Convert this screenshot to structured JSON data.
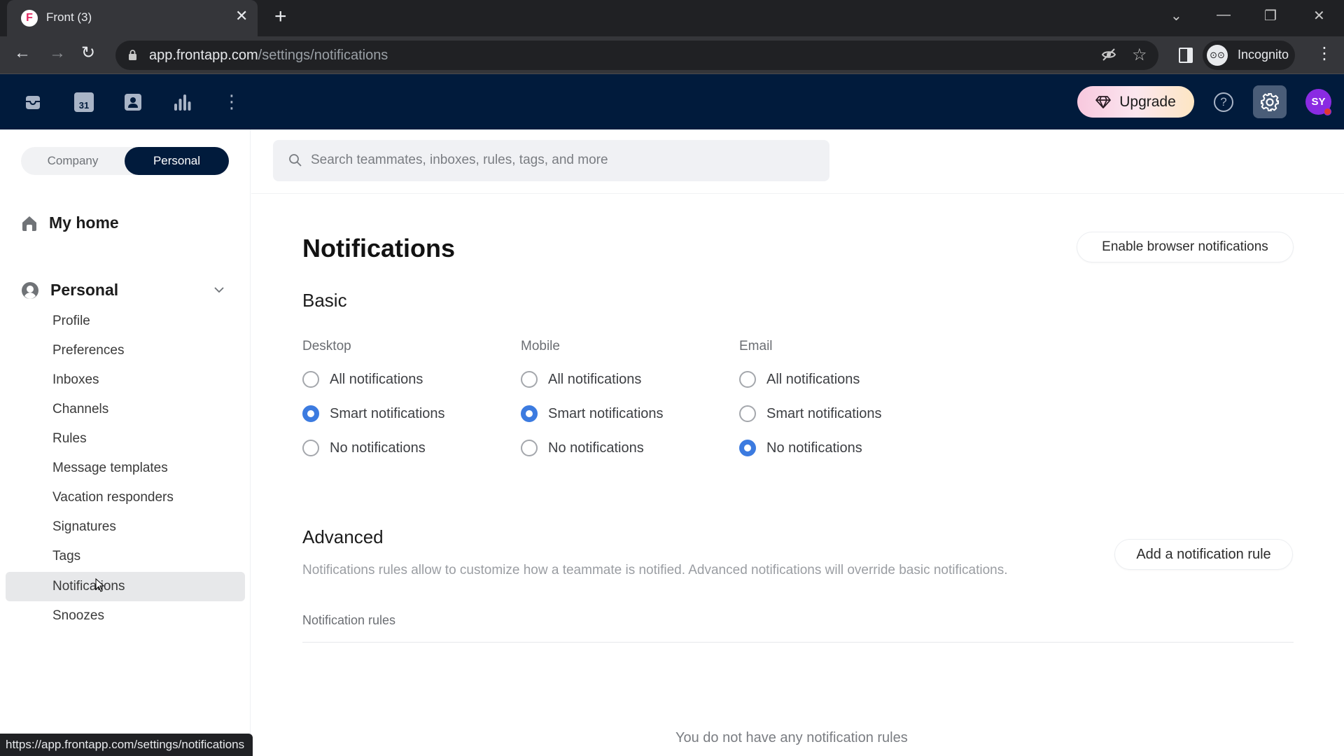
{
  "browser": {
    "tab_title": "Front (3)",
    "tab_favicon_letter": "F",
    "url_host": "app.frontapp.com",
    "url_path": "/settings/notifications",
    "profile_label": "Incognito",
    "status_url": "https://app.frontapp.com/settings/notifications"
  },
  "appbar": {
    "nav_icons": [
      "inbox-icon",
      "calendar-icon",
      "contacts-icon",
      "analytics-icon",
      "more-icon"
    ],
    "calendar_day": "31",
    "upgrade_label": "Upgrade",
    "avatar_initials": "SY",
    "colors": {
      "header_bg": "#011b3c",
      "avatar_bg": "#8a2be2",
      "notification_dot": "#e0382f"
    }
  },
  "sidebar": {
    "toggle": {
      "options": [
        "Company",
        "Personal"
      ],
      "selected": "Personal"
    },
    "home_label": "My home",
    "section_label": "Personal",
    "items": [
      {
        "label": "Profile",
        "active": false
      },
      {
        "label": "Preferences",
        "active": false
      },
      {
        "label": "Inboxes",
        "active": false
      },
      {
        "label": "Channels",
        "active": false
      },
      {
        "label": "Rules",
        "active": false
      },
      {
        "label": "Message templates",
        "active": false
      },
      {
        "label": "Vacation responders",
        "active": false
      },
      {
        "label": "Signatures",
        "active": false
      },
      {
        "label": "Tags",
        "active": false
      },
      {
        "label": "Notifications",
        "active": true
      },
      {
        "label": "Snoozes",
        "active": false
      }
    ]
  },
  "search": {
    "placeholder": "Search teammates, inboxes, rules, tags, and more"
  },
  "main": {
    "title": "Notifications",
    "enable_browser_label": "Enable browser notifications",
    "basic": {
      "title": "Basic",
      "columns": [
        {
          "label": "Desktop",
          "options": [
            "All notifications",
            "Smart notifications",
            "No notifications"
          ],
          "selected": "Smart notifications"
        },
        {
          "label": "Mobile",
          "options": [
            "All notifications",
            "Smart notifications",
            "No notifications"
          ],
          "selected": "Smart notifications"
        },
        {
          "label": "Email",
          "options": [
            "All notifications",
            "Smart notifications",
            "No notifications"
          ],
          "selected": "No notifications"
        }
      ]
    },
    "advanced": {
      "title": "Advanced",
      "description": "Notifications rules allow to customize how a teammate is notified. Advanced notifications will override basic notifications.",
      "add_rule_label": "Add a notification rule",
      "rules_header": "Notification rules",
      "empty_text": "You do not have any notification rules"
    },
    "accent_color": "#3c7be0"
  }
}
